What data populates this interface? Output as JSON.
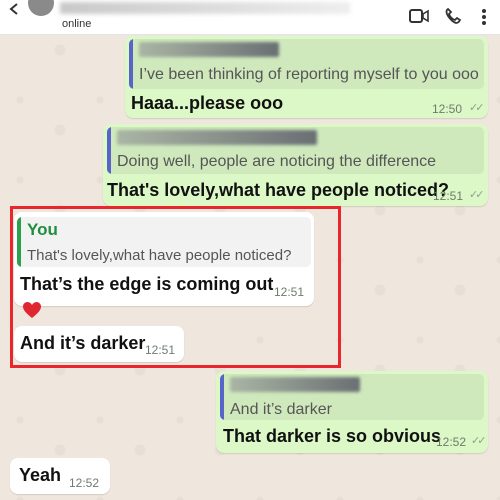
{
  "header": {
    "contact_status": "online",
    "icons": [
      "back-icon",
      "video-call-icon",
      "voice-call-icon",
      "menu-icon"
    ]
  },
  "messages": [
    {
      "direction": "outgoing",
      "quote_text": "I’ve been thinking of reporting myself to you ooo",
      "text": "Haaa...please ooo",
      "time": "12:50"
    },
    {
      "direction": "outgoing",
      "quote_text": "Doing well, people are noticing the difference",
      "text": "That's lovely,what have people noticed?",
      "time": "12:51"
    },
    {
      "direction": "incoming",
      "quote_author": "You",
      "quote_text": "That's lovely,what have people noticed?",
      "text": "That’s the edge is coming out",
      "time": "12:51"
    },
    {
      "direction": "incoming",
      "text": "❤️"
    },
    {
      "direction": "incoming",
      "text": "And it’s darker",
      "time": "12:51"
    },
    {
      "direction": "outgoing",
      "quote_text": "And it’s darker",
      "text": "That darker is so obvious",
      "time": "12:52"
    },
    {
      "direction": "incoming",
      "text": "Yeah",
      "time": "12:52"
    }
  ],
  "colors": {
    "outgoing_bubble": "#dcf8c6",
    "incoming_bubble": "#ffffff",
    "chat_background": "#efe7dd",
    "highlight_border": "#e8262b",
    "quote_bar_blue": "#5865c7",
    "quote_author_green": "#1f8f3f"
  }
}
